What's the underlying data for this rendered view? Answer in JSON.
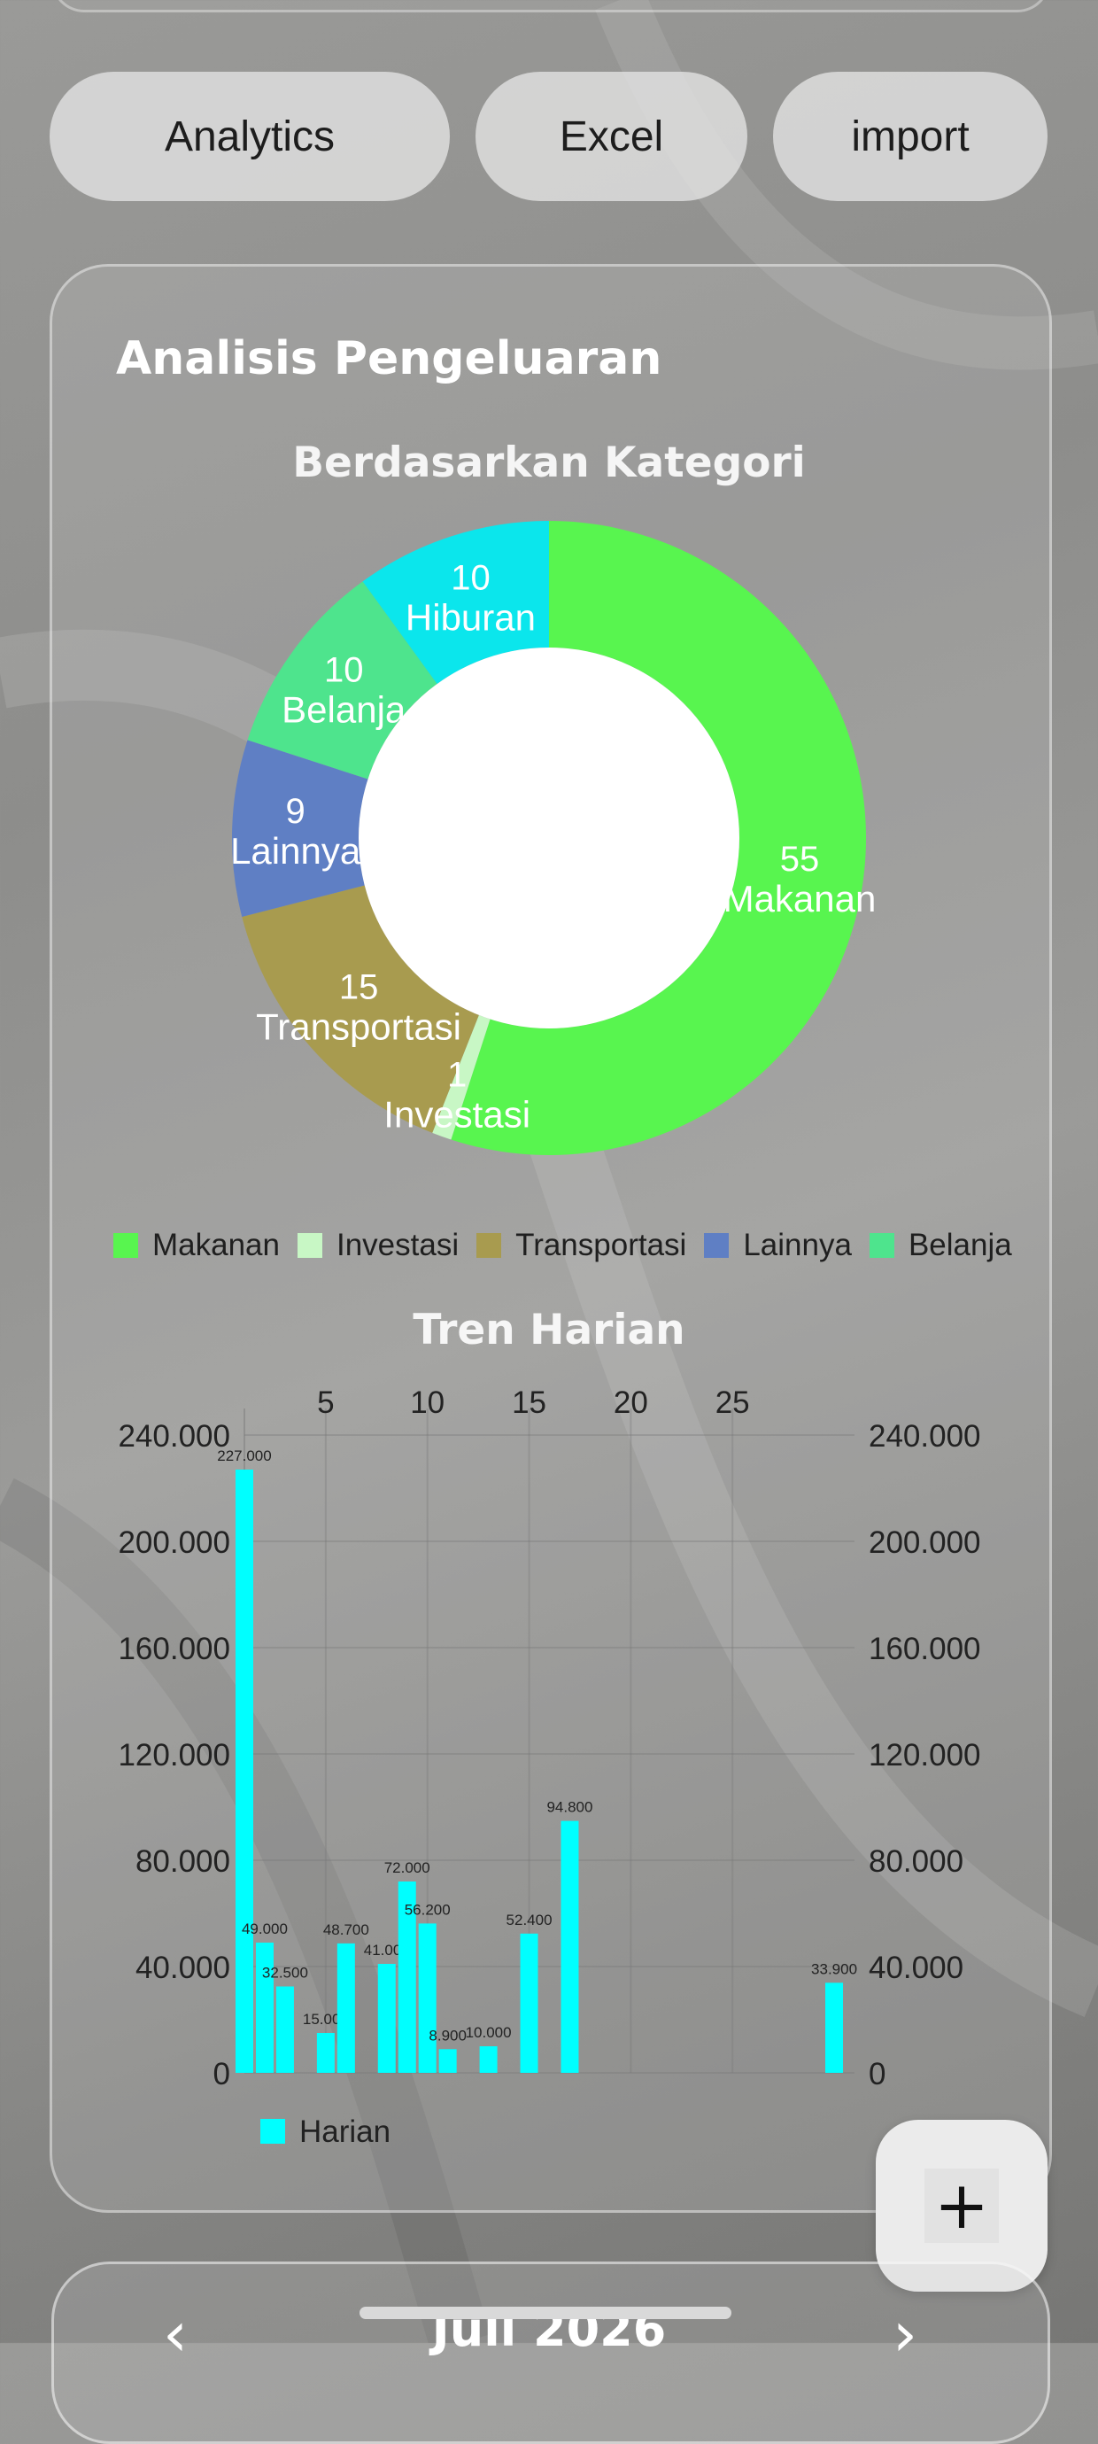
{
  "actions": {
    "analytics_label": "Analytics",
    "excel_label": "Excel",
    "import_label": "import"
  },
  "card": {
    "title": "Analisis Pengeluaran"
  },
  "colors": {
    "makanan": "#58f54f",
    "investasi": "#c8f7c5",
    "transportasi": "#a89b4f",
    "lainnya": "#5f7fc4",
    "belanja": "#4ee48d",
    "hiburan": "#0be6ec",
    "harian": "#00ffff"
  },
  "chart_data": [
    {
      "type": "pie",
      "title": "Berdasarkan Kategori",
      "donut": true,
      "start_angle_deg": 0,
      "direction": "clockwise",
      "slices": [
        {
          "label": "Makanan",
          "value": 55,
          "color": "#58f54f"
        },
        {
          "label": "Investasi",
          "value": 1,
          "color": "#c8f7c5"
        },
        {
          "label": "Transportasi",
          "value": 15,
          "color": "#a89b4f"
        },
        {
          "label": "Lainnya",
          "value": 9,
          "color": "#5f7fc4"
        },
        {
          "label": "Belanja",
          "value": 10,
          "color": "#4ee48d"
        },
        {
          "label": "Hiburan",
          "value": 10,
          "color": "#0be6ec"
        }
      ],
      "legend": [
        "Makanan",
        "Investasi",
        "Transportasi",
        "Lainnya",
        "Belanja"
      ],
      "legend_position": "bottom"
    },
    {
      "type": "bar",
      "title": "Tren Harian",
      "x_axis_position": "top",
      "xlim": [
        1,
        31
      ],
      "xticks": [
        "5",
        "10",
        "15",
        "20",
        "25"
      ],
      "xtick_values": [
        5,
        10,
        15,
        20,
        25
      ],
      "ylim": [
        0,
        240000
      ],
      "yticks": [
        "0",
        "40.000",
        "80.000",
        "120.000",
        "160.000",
        "200.000",
        "240.000"
      ],
      "ytick_values": [
        0,
        40000,
        80000,
        120000,
        160000,
        200000,
        240000
      ],
      "grid": true,
      "legend_position": "bottom-left",
      "series": [
        {
          "name": "Harian",
          "color": "#00ffff",
          "x": [
            1,
            2,
            3,
            5,
            6,
            8,
            9,
            10,
            11,
            13,
            15,
            17,
            30
          ],
          "values": [
            227000,
            49000,
            32500,
            15000,
            48700,
            41000,
            72000,
            56200,
            8900,
            10000,
            52400,
            94800,
            33900
          ],
          "labels": [
            "227.000",
            "49.000",
            "32.500",
            "15.000",
            "48.700",
            "41.000",
            "72.000",
            "56.200",
            "8.900",
            "10.000",
            "52.400",
            "94.800",
            "33.900"
          ]
        }
      ]
    }
  ],
  "fab": {
    "symbol": "+"
  },
  "footer": {
    "month": "Juli 2026",
    "prev_symbol": "‹",
    "next_symbol": "›"
  }
}
